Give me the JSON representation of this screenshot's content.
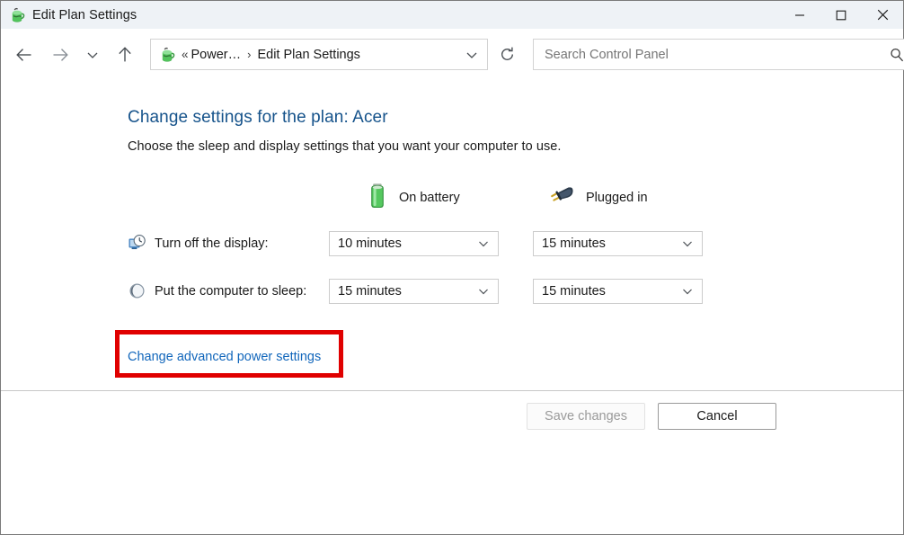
{
  "window": {
    "title": "Edit Plan Settings",
    "app_icon": "power-plan-icon",
    "controls": {
      "minimize": "minimize-icon",
      "maximize": "maximize-icon",
      "close": "close-icon"
    }
  },
  "nav": {
    "back": "back-arrow-icon",
    "forward": "forward-arrow-icon",
    "recent": "chevron-down-icon",
    "up": "up-arrow-icon",
    "address_icon": "power-plan-icon",
    "breadcrumb_overflow": "«",
    "breadcrumb": [
      {
        "label": "Power…"
      },
      {
        "label": "Edit Plan Settings"
      }
    ],
    "breadcrumb_separator": "›",
    "address_dropdown": "chevron-down-icon",
    "refresh": "refresh-icon"
  },
  "search": {
    "placeholder": "Search Control Panel",
    "value": "",
    "icon": "search-icon"
  },
  "main": {
    "title": "Change settings for the plan: Acer",
    "subtitle": "Choose the sleep and display settings that you want your computer to use.",
    "columns": [
      {
        "key": "battery",
        "label": "On battery",
        "icon": "battery-icon"
      },
      {
        "key": "plugged",
        "label": "Plugged in",
        "icon": "power-plug-icon"
      }
    ],
    "rows": [
      {
        "label": "Turn off the display:",
        "icon": "display-clock-icon",
        "battery_value": "10 minutes",
        "plugged_value": "15 minutes"
      },
      {
        "label": "Put the computer to sleep:",
        "icon": "sleep-moon-icon",
        "battery_value": "15 minutes",
        "plugged_value": "15 minutes"
      }
    ],
    "advanced_link": "Change advanced power settings",
    "highlight_color": "#e00000"
  },
  "footer": {
    "save_label": "Save changes",
    "cancel_label": "Cancel"
  }
}
